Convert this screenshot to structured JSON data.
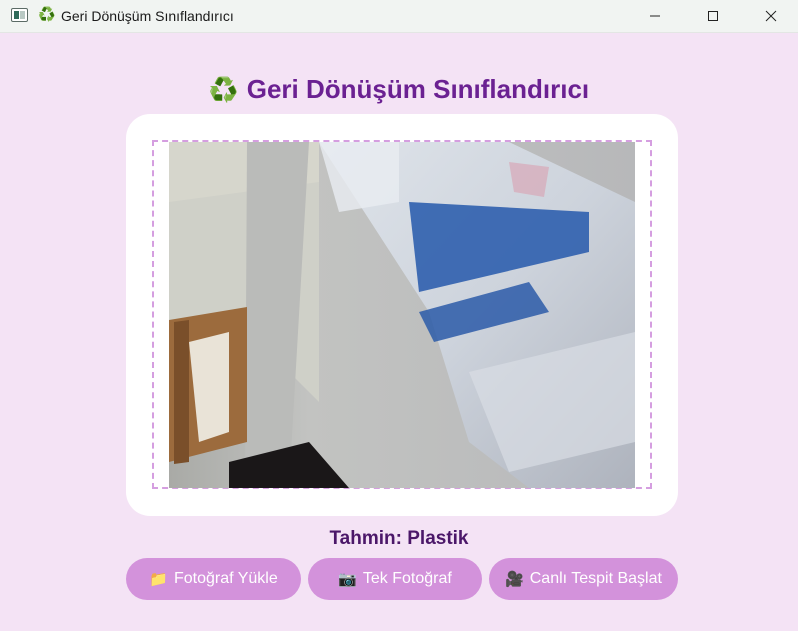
{
  "window": {
    "title": "Geri Dönüşüm Sınıflandırıcı",
    "title_emoji": "♻️"
  },
  "header": {
    "emoji": "♻️",
    "title": "Geri Dönüşüm Sınıflandırıcı"
  },
  "result": {
    "prediction_text": "Tahmin: Plastik"
  },
  "buttons": [
    {
      "icon": "📁",
      "label": "Fotoğraf Yükle"
    },
    {
      "icon": "📷",
      "label": "Tek Fotoğraf"
    },
    {
      "icon": "🎥",
      "label": "Canlı Tespit Başlat"
    }
  ],
  "colors": {
    "background": "#f4e3f5",
    "title_purple": "#6b2192",
    "button_pink": "#d392db",
    "dashed_border": "#d59ee0"
  },
  "icons": {
    "minimize": "minimize-icon",
    "maximize": "maximize-icon",
    "close": "close-icon",
    "photo": "camera-frame-image"
  }
}
